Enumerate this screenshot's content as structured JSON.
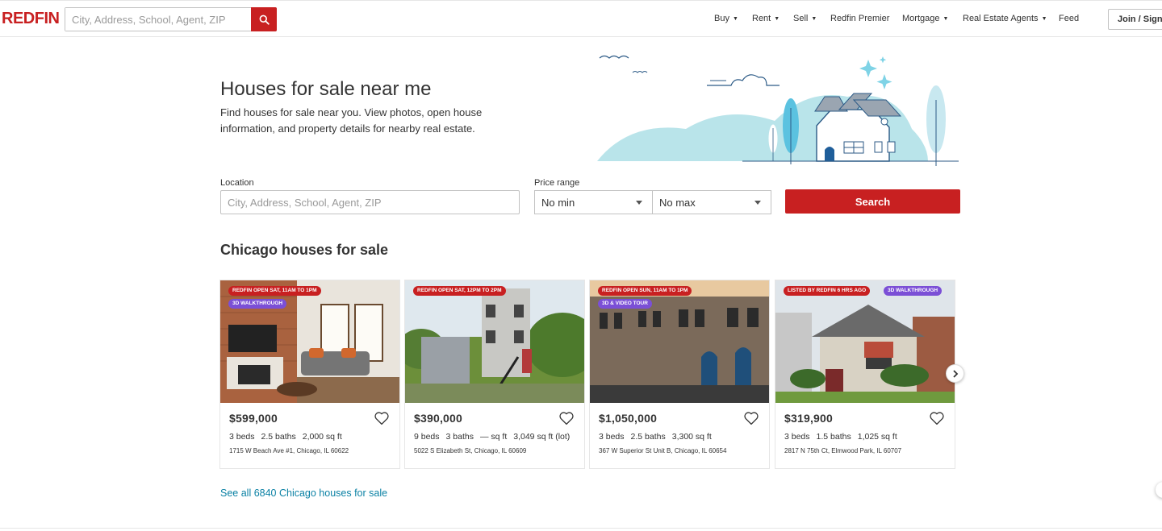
{
  "header": {
    "logo": "REDFIN",
    "search_placeholder": "City, Address, School, Agent, ZIP",
    "nav": [
      {
        "label": "Buy",
        "dropdown": true
      },
      {
        "label": "Rent",
        "dropdown": true
      },
      {
        "label": "Sell",
        "dropdown": true
      },
      {
        "label": "Redfin Premier",
        "dropdown": false
      },
      {
        "label": "Mortgage",
        "dropdown": true
      },
      {
        "label": "Real Estate Agents",
        "dropdown": true
      },
      {
        "label": "Feed",
        "dropdown": false
      }
    ],
    "signin_label": "Join / Sign in"
  },
  "hero": {
    "title": "Houses for sale near me",
    "description": "Find houses for sale near you. View photos, open house information, and property details for nearby real estate."
  },
  "search_form": {
    "location_label": "Location",
    "location_placeholder": "City, Address, School, Agent, ZIP",
    "price_label": "Price range",
    "min_value": "No min",
    "max_value": "No max",
    "search_button": "Search"
  },
  "listings_section": {
    "title": "Chicago houses for sale",
    "see_all": "See all 6840 Chicago houses for sale",
    "listings": [
      {
        "badges": [
          {
            "text": "REDFIN OPEN SAT, 11AM TO 1PM",
            "color": "red"
          },
          {
            "text": "3D WALKTHROUGH",
            "color": "purple"
          }
        ],
        "price": "$599,000",
        "beds": "3 beds",
        "baths": "2.5 baths",
        "sqft": "2,000 sq ft",
        "address": "1715 W Beach Ave #1, Chicago, IL 60622"
      },
      {
        "badges": [
          {
            "text": "REDFIN OPEN SAT, 12PM TO 2PM",
            "color": "red"
          }
        ],
        "price": "$390,000",
        "beds": "9 beds",
        "baths": "3 baths",
        "sqft": "— sq ft",
        "lot": "3,049 sq ft (lot)",
        "address": "5022 S Elizabeth St, Chicago, IL 60609"
      },
      {
        "badges": [
          {
            "text": "REDFIN OPEN SUN, 11AM TO 1PM",
            "color": "red"
          },
          {
            "text": "3D & VIDEO TOUR",
            "color": "purple"
          }
        ],
        "price": "$1,050,000",
        "beds": "3 beds",
        "baths": "2.5 baths",
        "sqft": "3,300 sq ft",
        "address": "367 W Superior St Unit B, Chicago, IL 60654"
      },
      {
        "badges": [
          {
            "text": "LISTED BY REDFIN 6 HRS AGO",
            "color": "red"
          },
          {
            "text": "3D WALKTHROUGH",
            "color": "purple"
          }
        ],
        "price": "$319,900",
        "beds": "3 beds",
        "baths": "1.5 baths",
        "sqft": "1,025 sq ft",
        "address": "2817 N 75th Ct, Elmwood Park, IL 60707"
      }
    ]
  },
  "colors": {
    "brand_red": "#c82021",
    "link_blue": "#0c82a5",
    "badge_purple": "#7b4fd6",
    "illustration_teal": "#b9e4ea"
  }
}
